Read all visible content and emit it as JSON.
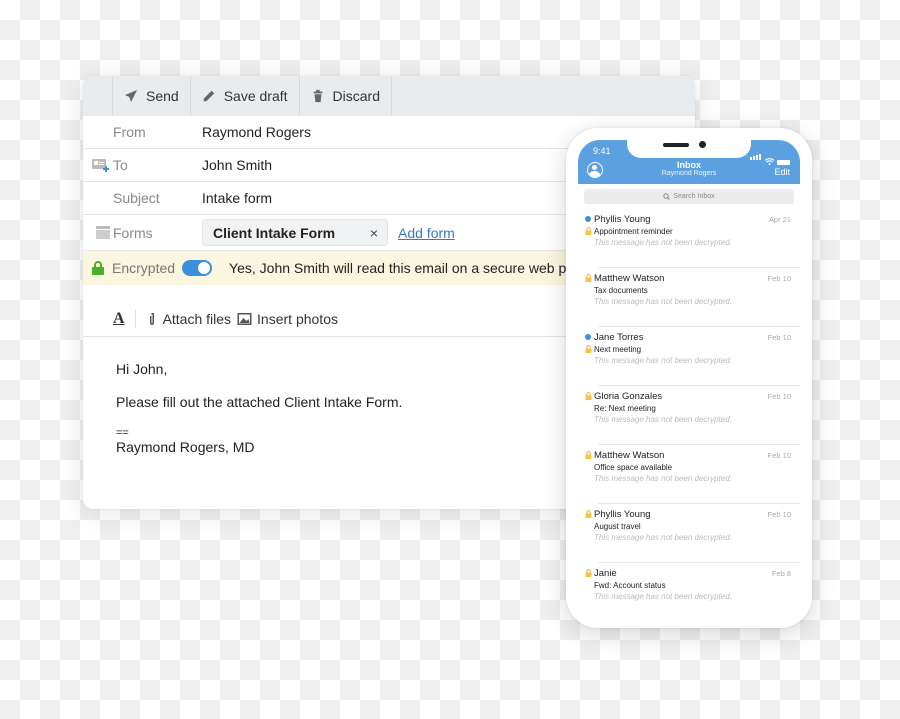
{
  "compose": {
    "toolbar": {
      "send": "Send",
      "save_draft": "Save draft",
      "discard": "Discard"
    },
    "from": {
      "label": "From",
      "value": "Raymond Rogers"
    },
    "to": {
      "label": "To",
      "value": "John Smith"
    },
    "subject": {
      "label": "Subject",
      "value": "Intake form"
    },
    "forms": {
      "label": "Forms",
      "chip": "Client Intake Form",
      "remove": "×",
      "add": "Add form"
    },
    "encryption": {
      "label": "Encrypted",
      "enabled": true,
      "message": "Yes, John Smith will read this email on a secure web pa",
      "accent": "#3d8fdd"
    },
    "format_bar": {
      "text_format": "A",
      "attach": "Attach files",
      "insert_photos": "Insert photos"
    },
    "body": {
      "greeting": "Hi John,",
      "line1": "Please fill out the attached Client Intake Form.",
      "sig_sep": "==",
      "signature": "Raymond Rogers, MD"
    }
  },
  "phone": {
    "time": "9:41",
    "title": "Inbox",
    "subtitle": "Raymond Rogers",
    "edit": "Edit",
    "search_placeholder": "Search Inbox",
    "header_color": "#5ba0e0",
    "messages": [
      {
        "sender": "Phyllis Young",
        "subject": "Appointment reminder",
        "date": "Apr 21",
        "unread": true,
        "preview": "This message has not been decrypted."
      },
      {
        "sender": "Matthew Watson",
        "subject": "Tax documents",
        "date": "Feb 10",
        "unread": false,
        "preview": "This message has not been decrypted."
      },
      {
        "sender": "Jane Torres",
        "subject": "Next meeting",
        "date": "Feb 10",
        "unread": true,
        "preview": "This message has not been decrypted."
      },
      {
        "sender": "Gloria Gonzales",
        "subject": "Re: Next meeting",
        "date": "Feb 10",
        "unread": false,
        "preview": "This message has not been decrypted."
      },
      {
        "sender": "Matthew Watson",
        "subject": "Office space available",
        "date": "Feb 10",
        "unread": false,
        "preview": "This message has not been decrypted."
      },
      {
        "sender": "Phyllis Young",
        "subject": "August travel",
        "date": "Feb 10",
        "unread": false,
        "preview": "This message has not been decrypted."
      },
      {
        "sender": "Janie",
        "subject": "Fwd: Account status",
        "date": "Feb 8",
        "unread": false,
        "preview": "This message has not been decrypted."
      }
    ]
  }
}
